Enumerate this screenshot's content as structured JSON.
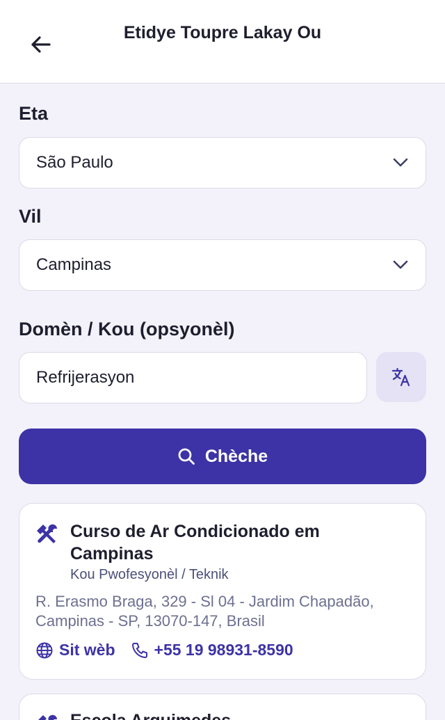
{
  "header": {
    "title": "Etidye Toupre Lakay Ou",
    "back_icon": "arrow-left-icon"
  },
  "form": {
    "state": {
      "label": "Eta",
      "value": "São Paulo"
    },
    "city": {
      "label": "Vil",
      "value": "Campinas"
    },
    "domain": {
      "label": "Domèn / Kou (opsyonèl)",
      "value": "Refrijerasyon",
      "placeholder": ""
    },
    "translate_icon": "translate-icon",
    "search_label": "Chèche"
  },
  "results": [
    {
      "title": "Curso de Ar Condicionado em Campinas",
      "category": "Kou Pwofesyonèl / Teknik",
      "address": "R. Erasmo Braga, 329 - Sl 04 - Jardim Chapadão, Campinas - SP, 13070-147, Brasil",
      "website_label": "Sit wèb",
      "phone": "+55 19 98931-8590",
      "icon": "tools-icon"
    },
    {
      "title": "Escola Arquimedes",
      "icon": "tools-icon"
    }
  ],
  "colors": {
    "accent": "#3d33a6",
    "background": "#f3f2fa",
    "card": "#ffffff"
  }
}
